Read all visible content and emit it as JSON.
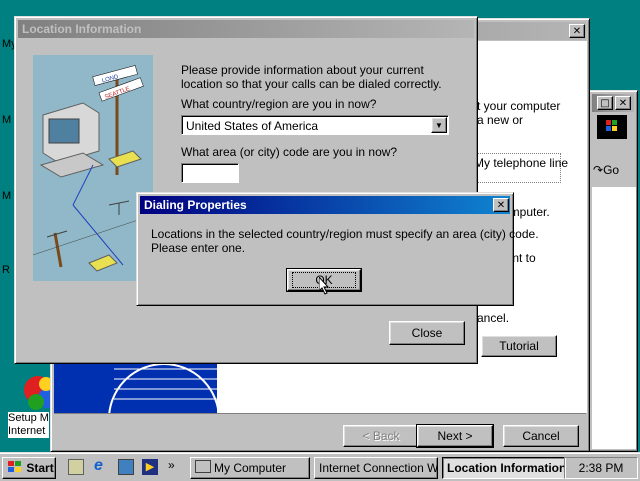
{
  "desktop": {
    "icons": [
      "My",
      "M",
      "M",
      "R"
    ],
    "setup_label_line1": "Setup M",
    "setup_label_line2": "Internet"
  },
  "back_window": {
    "close": "✕",
    "text_fragments": [
      "t your computer",
      "a new or",
      "My telephone line",
      "computer.",
      "want to",
      "ancel."
    ],
    "tutorial": "Tutorial"
  },
  "browser": {
    "go": "Go"
  },
  "wizard": {
    "back": "< Back",
    "next": "Next >",
    "cancel": "Cancel"
  },
  "location_window": {
    "title": "Location Information",
    "intro": "Please provide information about your current location so that your calls can be dialed correctly.",
    "country_label": "What country/region are you in now?",
    "country_value": "United States of America",
    "area_label": "What area (or city) code are you in now?",
    "area_value": "",
    "close_button": "Close"
  },
  "dialog": {
    "title": "Dialing Properties",
    "message_line1": "Locations in the selected country/region must specify an area (city) code.",
    "message_line2": "Please enter one.",
    "ok": "OK",
    "close": "✕"
  },
  "taskbar": {
    "start": "Start",
    "items": [
      "My Computer",
      "Internet Connection W...",
      "Location Information"
    ],
    "clock": "2:38 PM"
  },
  "illustration": {
    "sign1": "LOND",
    "sign2": "SEATTLE"
  }
}
